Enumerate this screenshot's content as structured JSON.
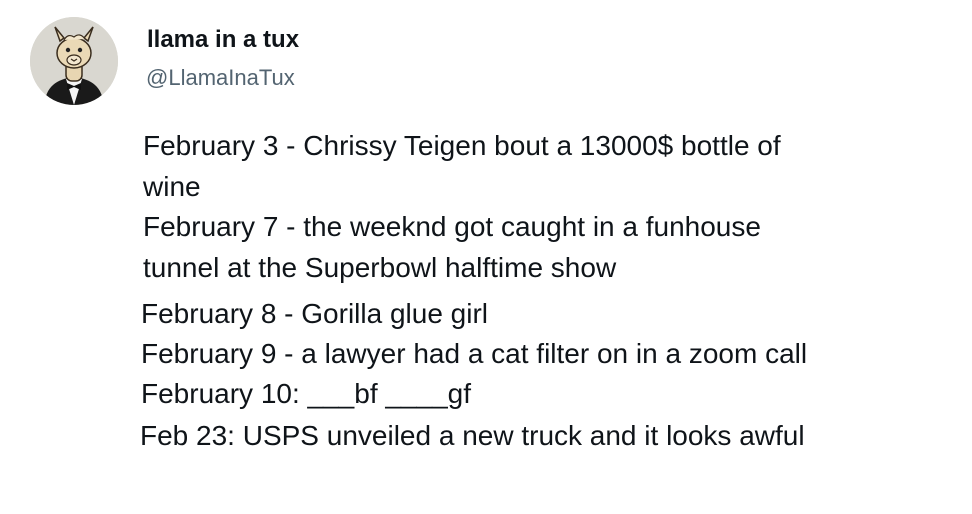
{
  "tweet": {
    "author": {
      "display_name": "llama in a tux",
      "handle": "@LlamaInaTux",
      "avatar_icon": "llama-in-tuxedo-avatar"
    },
    "lines": [
      "February 3 - Chrissy Teigen bout a 13000$ bottle of",
      "wine",
      "February 7 - the weeknd got caught in a funhouse",
      "tunnel at the Superbowl halftime show",
      "February 8 - Gorilla glue girl",
      "February 9 - a lawyer had a cat filter on in a zoom call",
      "February 10: ___bf ____gf",
      "Feb 23: USPS unveiled a new truck and it looks awful"
    ]
  },
  "colors": {
    "text": "#0f1419",
    "secondary_text": "#536471",
    "background": "#ffffff"
  }
}
